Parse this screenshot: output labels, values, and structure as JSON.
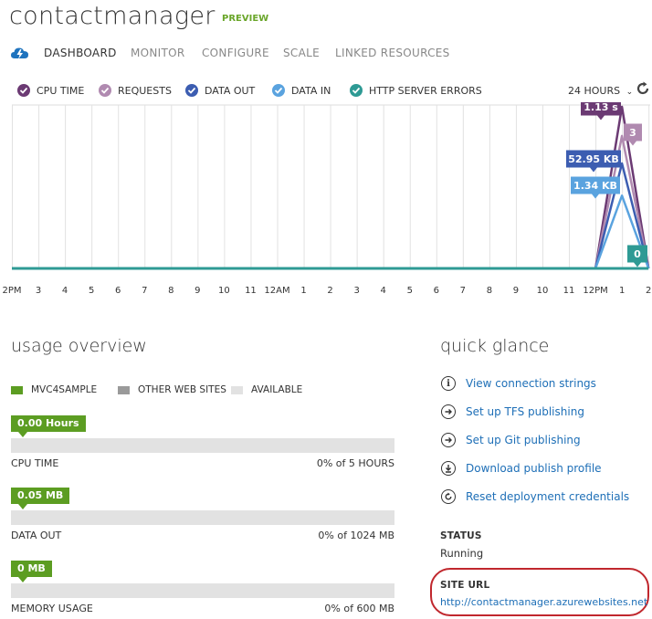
{
  "header": {
    "title": "contactmanager",
    "badge": "PREVIEW",
    "accent_color": "#6aa62a"
  },
  "nav": {
    "icon": "cloud-lightning-icon",
    "tabs": [
      {
        "label": "DASHBOARD",
        "active": true
      },
      {
        "label": "MONITOR",
        "active": false
      },
      {
        "label": "CONFIGURE",
        "active": false
      },
      {
        "label": "SCALE",
        "active": false
      },
      {
        "label": "LINKED RESOURCES",
        "active": false
      }
    ]
  },
  "metrics_legend": [
    {
      "label": "CPU TIME",
      "color": "#6b3a73"
    },
    {
      "label": "REQUESTS",
      "color": "#b08ab0"
    },
    {
      "label": "DATA OUT",
      "color": "#3c5db1"
    },
    {
      "label": "DATA IN",
      "color": "#5aa3df"
    },
    {
      "label": "HTTP SERVER ERRORS",
      "color": "#2e9a94"
    }
  ],
  "time_range": {
    "label": "24 HOURS"
  },
  "chart_data": {
    "type": "line",
    "x": [
      "2PM",
      "3",
      "4",
      "5",
      "6",
      "7",
      "8",
      "9",
      "10",
      "11",
      "12AM",
      "1",
      "2",
      "3",
      "4",
      "5",
      "6",
      "7",
      "8",
      "9",
      "10",
      "11",
      "12PM",
      "1",
      "2"
    ],
    "series": [
      {
        "name": "CPU TIME",
        "color": "#6b3a73",
        "values": [
          0,
          0,
          0,
          0,
          0,
          0,
          0,
          0,
          0,
          0,
          0,
          0,
          0,
          0,
          0,
          0,
          0,
          0,
          0,
          0,
          0,
          0,
          0,
          1,
          0
        ],
        "label": "1.13 s"
      },
      {
        "name": "REQUESTS",
        "color": "#b08ab0",
        "values": [
          0,
          0,
          0,
          0,
          0,
          0,
          0,
          0,
          0,
          0,
          0,
          0,
          0,
          0,
          0,
          0,
          0,
          0,
          0,
          0,
          0,
          0,
          0,
          0.82,
          0
        ],
        "label": "3"
      },
      {
        "name": "DATA OUT",
        "color": "#3c5db1",
        "values": [
          0,
          0,
          0,
          0,
          0,
          0,
          0,
          0,
          0,
          0,
          0,
          0,
          0,
          0,
          0,
          0,
          0,
          0,
          0,
          0,
          0,
          0,
          0,
          0.65,
          0
        ],
        "label": "52.95 KB"
      },
      {
        "name": "DATA IN",
        "color": "#5aa3df",
        "values": [
          0,
          0,
          0,
          0,
          0,
          0,
          0,
          0,
          0,
          0,
          0,
          0,
          0,
          0,
          0,
          0,
          0,
          0,
          0,
          0,
          0,
          0,
          0,
          0.45,
          0
        ],
        "label": "1.34 KB"
      },
      {
        "name": "HTTP SERVER ERRORS",
        "color": "#2e9a94",
        "values": [
          0,
          0,
          0,
          0,
          0,
          0,
          0,
          0,
          0,
          0,
          0,
          0,
          0,
          0,
          0,
          0,
          0,
          0,
          0,
          0,
          0,
          0,
          0,
          0,
          0
        ],
        "label": "0"
      }
    ],
    "ylim": [
      0,
      1
    ],
    "grid": true
  },
  "usage": {
    "title": "usage overview",
    "legend": [
      {
        "label": "MVC4SAMPLE",
        "color": "#5c9d22"
      },
      {
        "label": "OTHER WEB SITES",
        "color": "#9a9a9a"
      },
      {
        "label": "AVAILABLE",
        "color": "#e2e2e2"
      }
    ],
    "rows": [
      {
        "badge": "0.00 Hours",
        "label": "CPU TIME",
        "value": "0% of 5 HOURS",
        "percent": 0
      },
      {
        "badge": "0.05 MB",
        "label": "DATA OUT",
        "value": "0% of 1024 MB",
        "percent": 0
      },
      {
        "badge": "0 MB",
        "label": "MEMORY USAGE",
        "value": "0% of 600 MB",
        "percent": 0
      }
    ]
  },
  "quick_glance": {
    "title": "quick glance",
    "links": [
      {
        "label": "View connection strings",
        "icon": "info-icon"
      },
      {
        "label": "Set up TFS publishing",
        "icon": "arrow-right-icon"
      },
      {
        "label": "Set up Git publishing",
        "icon": "arrow-right-icon"
      },
      {
        "label": "Download publish profile",
        "icon": "download-icon"
      },
      {
        "label": "Reset deployment credentials",
        "icon": "reset-icon"
      }
    ],
    "status_label": "STATUS",
    "status_value": "Running",
    "site_url_label": "SITE URL",
    "site_url": "http://contactmanager.azurewebsites.net"
  }
}
